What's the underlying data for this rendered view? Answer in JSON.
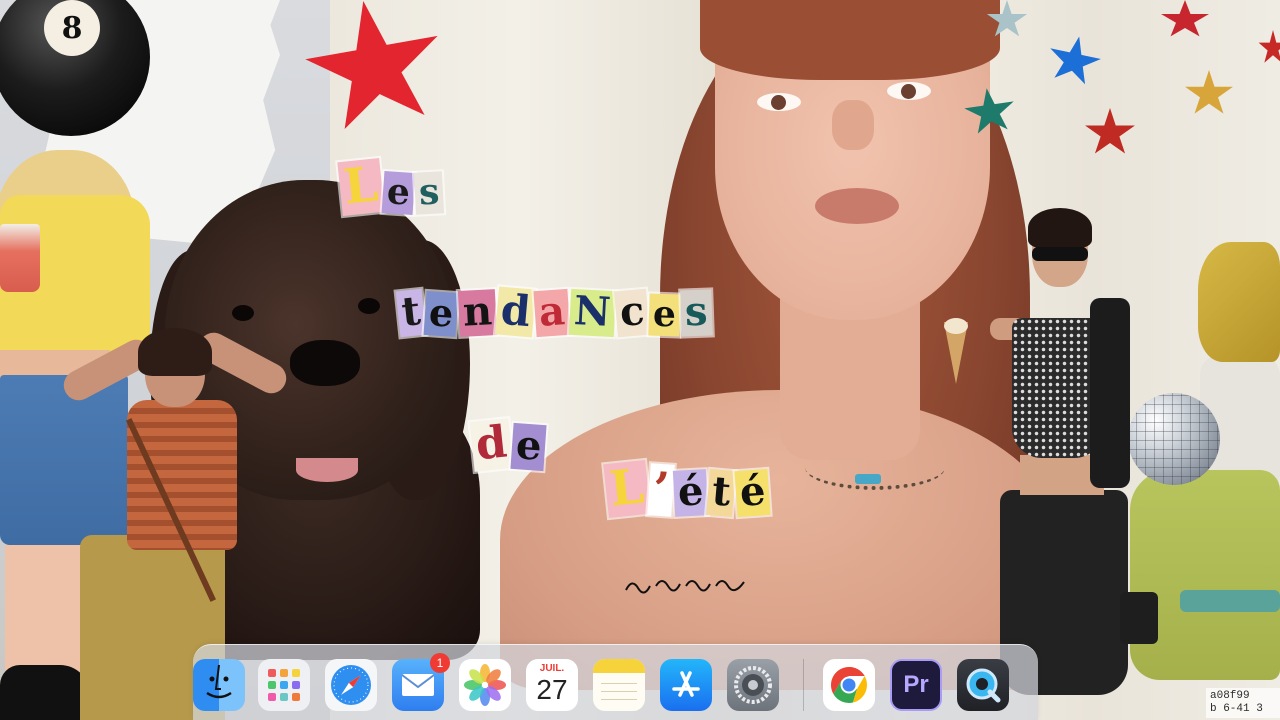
{
  "title": {
    "line1": [
      {
        "char": "L",
        "bg": "#f4b9c3",
        "fg": "#f6d43b",
        "size": 48
      },
      {
        "char": "e",
        "bg": "#b59cda",
        "fg": "#1a1a1a",
        "size": 36
      },
      {
        "char": "s",
        "bg": "#e9e4dc",
        "fg": "#1f5f5f",
        "size": 36
      }
    ],
    "line2": [
      {
        "char": "t",
        "bg": "#c9b5e6",
        "fg": "#1a1a1a",
        "size": 40
      },
      {
        "char": "e",
        "bg": "#7f8fcc",
        "fg": "#101010",
        "size": 38
      },
      {
        "char": "n",
        "bg": "#d87aa0",
        "fg": "#141414",
        "size": 40
      },
      {
        "char": "d",
        "bg": "#f2e9a8",
        "fg": "#1b2f6a",
        "size": 42
      },
      {
        "char": "a",
        "bg": "#f4a7a9",
        "fg": "#c02a37",
        "size": 40
      },
      {
        "char": "N",
        "bg": "#d9ec8b",
        "fg": "#1b2f6a",
        "size": 40
      },
      {
        "char": "c",
        "bg": "#f2e3cf",
        "fg": "#111111",
        "size": 40
      },
      {
        "char": "e",
        "bg": "#f3e07a",
        "fg": "#111111",
        "size": 36
      },
      {
        "char": "s",
        "bg": "#d6d0cb",
        "fg": "#185a5a",
        "size": 40
      }
    ],
    "line3": [
      {
        "char": "d",
        "bg": "#f7f2e6",
        "fg": "#b02a3a",
        "size": 44
      },
      {
        "char": "e",
        "bg": "#a28ed0",
        "fg": "#111111",
        "size": 40
      }
    ],
    "line4": [
      {
        "char": "L",
        "bg": "#f4b9c3",
        "fg": "#f6d43b",
        "size": 48
      },
      {
        "char": "’",
        "bg": "#ffffff",
        "fg": "#b23a2a",
        "size": 46
      },
      {
        "char": "é",
        "bg": "#c4b3e6",
        "fg": "#111111",
        "size": 40
      },
      {
        "char": "t",
        "bg": "#f4d89a",
        "fg": "#111111",
        "size": 40
      },
      {
        "char": "é",
        "bg": "#f4e06a",
        "fg": "#111111",
        "size": 40
      }
    ]
  },
  "ball8": {
    "number": "8"
  },
  "dock": {
    "apps": [
      {
        "name": "finder",
        "icon": "finder-icon",
        "bg": "#3c8ef0"
      },
      {
        "name": "launchpad",
        "icon": "launchpad-icon",
        "bg": "#f2f2f2"
      },
      {
        "name": "safari",
        "icon": "safari-icon",
        "bg": "#f4f6f8"
      },
      {
        "name": "mail",
        "icon": "mail-icon",
        "bg": "#3e8ef6",
        "badge": "1"
      },
      {
        "name": "photos",
        "icon": "photos-icon",
        "bg": "#ffffff"
      },
      {
        "name": "calendar",
        "icon": "calendar-icon",
        "bg": "#ffffff",
        "month": "JUIL.",
        "day": "27"
      },
      {
        "name": "notes",
        "icon": "notes-icon",
        "bg": "#fff7d1"
      },
      {
        "name": "app-store",
        "icon": "app-store-icon",
        "bg": "#1f8ef1"
      },
      {
        "name": "system-preferences",
        "icon": "gear-icon",
        "bg": "#8a8f97"
      },
      {
        "name": "chrome",
        "icon": "chrome-icon",
        "bg": "#ffffff"
      },
      {
        "name": "premiere-pro",
        "icon": "premiere-icon",
        "bg": "#1e1a3c",
        "label": "Pr"
      },
      {
        "name": "quicktime",
        "icon": "quicktime-icon",
        "bg": "#2b2d33"
      }
    ]
  },
  "corner_text": {
    "line1": "a08f99",
    "line2": "b 6-41 3"
  }
}
